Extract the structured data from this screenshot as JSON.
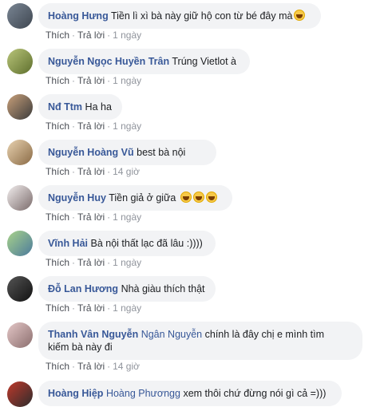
{
  "actions": {
    "like": "Thích",
    "reply": "Trả lời",
    "sep": "·"
  },
  "comments": [
    {
      "author": "Hoàng Hưng",
      "text": "Tiền lì xì bà này giữ hộ con từ bé đây mà",
      "time": "1 ngày",
      "emoji_count": 1
    },
    {
      "author": "Nguyễn Ngọc Huyền Trân",
      "text": "Trúng Vietlot à",
      "time": "1 ngày"
    },
    {
      "author": "Nđ Ttm",
      "text": "Ha ha",
      "time": "1 ngày"
    },
    {
      "author": "Nguyễn Hoàng Vũ",
      "text": "best bà nội",
      "time": "14 giờ"
    },
    {
      "author": "Nguyễn Huy",
      "text": "Tiền giả ở giữa",
      "time": "1 ngày",
      "emoji_count": 3
    },
    {
      "author": "Vĩnh Hải",
      "text": "Bà nội thất lạc đã lâu :))))",
      "time": "1 ngày"
    },
    {
      "author": "Đỗ Lan Hương",
      "text": "Nhà giàu thích thật",
      "time": "1 ngày"
    },
    {
      "author": "Thanh Vân Nguyễn",
      "mention": "Ngân Nguyễn",
      "text_line1": "chính là đây chị e mình tìm",
      "text_line2": "kiếm bà này đi",
      "time": "14 giờ"
    },
    {
      "author": "Hoàng Hiệp",
      "mention": "Hoàng Phươngg",
      "text": "xem thôi chứ đừng nói gì cả =)))"
    }
  ]
}
